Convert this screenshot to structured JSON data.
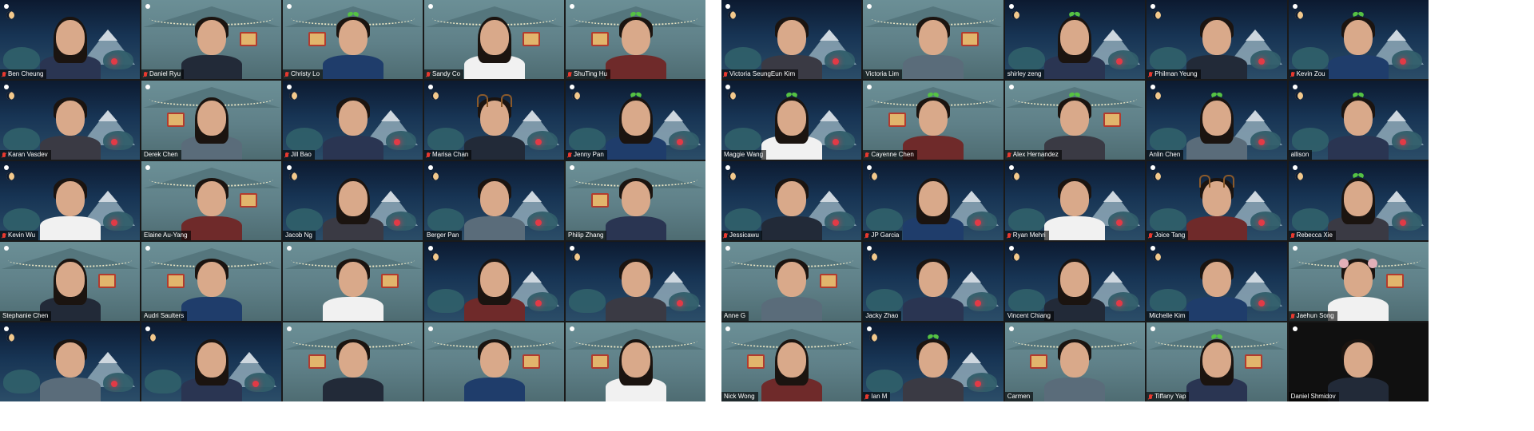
{
  "screens": [
    {
      "tiles": [
        {
          "name": "Ben Cheung",
          "muted": true,
          "bg": "night",
          "acc": ""
        },
        {
          "name": "Daniel Ryu",
          "muted": true,
          "bg": "cabin",
          "acc": ""
        },
        {
          "name": "Christy Lo",
          "muted": true,
          "bg": "cabin",
          "acc": "sprout"
        },
        {
          "name": "Sandy Co",
          "muted": true,
          "bg": "cabin",
          "acc": ""
        },
        {
          "name": "ShuTing Hu",
          "muted": true,
          "bg": "cabin",
          "acc": "sprout"
        },
        {
          "name": "Karan Vasdev",
          "muted": true,
          "bg": "night",
          "acc": ""
        },
        {
          "name": "Derek Chen",
          "muted": false,
          "bg": "cabin",
          "acc": ""
        },
        {
          "name": "Jill Bao",
          "muted": true,
          "bg": "night",
          "acc": ""
        },
        {
          "name": "Marisa Chan",
          "muted": true,
          "bg": "night",
          "acc": "antlers"
        },
        {
          "name": "Jenny Pan",
          "muted": true,
          "bg": "night",
          "acc": "sprout"
        },
        {
          "name": "Kevin Wu",
          "muted": true,
          "bg": "night",
          "acc": ""
        },
        {
          "name": "Elaine Au-Yang",
          "muted": false,
          "bg": "cabin",
          "acc": ""
        },
        {
          "name": "Jacob Ng",
          "muted": false,
          "bg": "night",
          "acc": ""
        },
        {
          "name": "Berger Pan",
          "muted": false,
          "bg": "night",
          "acc": ""
        },
        {
          "name": "Philip Zhang",
          "muted": false,
          "bg": "cabin",
          "acc": ""
        },
        {
          "name": "Stephanie Chen",
          "muted": false,
          "bg": "cabin",
          "acc": ""
        },
        {
          "name": "Audri Saulters",
          "muted": false,
          "bg": "cabin",
          "acc": ""
        },
        {
          "name": "",
          "muted": false,
          "bg": "cabin",
          "acc": ""
        },
        {
          "name": "",
          "muted": false,
          "bg": "night",
          "acc": ""
        },
        {
          "name": "",
          "muted": false,
          "bg": "night",
          "acc": ""
        },
        {
          "name": "",
          "muted": false,
          "bg": "night",
          "acc": ""
        },
        {
          "name": "",
          "muted": false,
          "bg": "night",
          "acc": ""
        },
        {
          "name": "",
          "muted": false,
          "bg": "cabin",
          "acc": ""
        },
        {
          "name": "",
          "muted": false,
          "bg": "cabin",
          "acc": ""
        },
        {
          "name": "",
          "muted": false,
          "bg": "cabin",
          "acc": ""
        }
      ]
    },
    {
      "tiles": [
        {
          "name": "Victoria SeungEun Kim",
          "muted": true,
          "bg": "night",
          "acc": ""
        },
        {
          "name": "Victoria Lim",
          "muted": false,
          "bg": "cabin",
          "acc": ""
        },
        {
          "name": "shirley zeng",
          "muted": false,
          "bg": "night",
          "acc": "sprout"
        },
        {
          "name": "Philman Yeung",
          "muted": true,
          "bg": "night",
          "acc": ""
        },
        {
          "name": "Kevin Zou",
          "muted": true,
          "bg": "night",
          "acc": "sprout"
        },
        {
          "name": "Maggie Wang",
          "muted": false,
          "bg": "night",
          "acc": "sprout"
        },
        {
          "name": "Cayenne Chen",
          "muted": true,
          "bg": "cabin",
          "acc": "sprout"
        },
        {
          "name": "Alex Hernandez",
          "muted": true,
          "bg": "cabin",
          "acc": "sprout"
        },
        {
          "name": "Anlin Chen",
          "muted": false,
          "bg": "night",
          "acc": "sprout"
        },
        {
          "name": "allison",
          "muted": false,
          "bg": "night",
          "acc": "sprout"
        },
        {
          "name": "Jessicawu",
          "muted": true,
          "bg": "night",
          "acc": ""
        },
        {
          "name": "JP Garcia",
          "muted": true,
          "bg": "night",
          "acc": ""
        },
        {
          "name": "Ryan Mehri",
          "muted": true,
          "bg": "night",
          "acc": ""
        },
        {
          "name": "Joice Tang",
          "muted": true,
          "bg": "night",
          "acc": "antlers"
        },
        {
          "name": "Rebecca Xie",
          "muted": true,
          "bg": "night",
          "acc": "sprout"
        },
        {
          "name": "Anne G",
          "muted": false,
          "bg": "cabin",
          "acc": ""
        },
        {
          "name": "Jacky Zhao",
          "muted": false,
          "bg": "night",
          "acc": ""
        },
        {
          "name": "Vincent Chiang",
          "muted": false,
          "bg": "night",
          "acc": ""
        },
        {
          "name": "Michelle Kim",
          "muted": false,
          "bg": "night",
          "acc": ""
        },
        {
          "name": "Jaehun Song",
          "muted": true,
          "bg": "cabin",
          "acc": "ears"
        },
        {
          "name": "Nick Wong",
          "muted": false,
          "bg": "cabin",
          "acc": ""
        },
        {
          "name": "Ian M",
          "muted": true,
          "bg": "night",
          "acc": "sprout"
        },
        {
          "name": "Carmen",
          "muted": false,
          "bg": "cabin",
          "acc": ""
        },
        {
          "name": "Tiffany Yap",
          "muted": true,
          "bg": "cabin",
          "acc": "sprout"
        },
        {
          "name": "Daniel Shmidov",
          "muted": false,
          "bg": "dark",
          "acc": ""
        }
      ]
    }
  ]
}
